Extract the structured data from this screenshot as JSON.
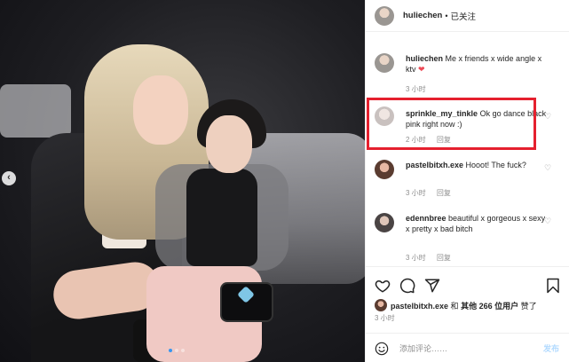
{
  "photo": {
    "nav_prev_icon": "chevron-left-icon",
    "dots_count": 3,
    "active_dot": 0
  },
  "header": {
    "username": "huliechen",
    "separator": "•",
    "follow_status": "已关注"
  },
  "comments": [
    {
      "username": "huliechen",
      "text": "Me x friends x wide angle x ktv",
      "emoji": "❤",
      "time": "3 小时",
      "reply": ""
    },
    {
      "username": "sprinkle_my_tinkle",
      "text": "Ok go dance black pink right now :)",
      "time": "2 小时",
      "reply": "回复"
    },
    {
      "username": "pastelbitxh.exe",
      "text": "Hooot! The fuck?",
      "time": "3 小时",
      "reply": "回复"
    },
    {
      "username": "edennbree",
      "text": "beautiful x gorgeous x sexy x pretty x bad bitch",
      "time": "3 小时",
      "reply": "回复"
    }
  ],
  "likes": {
    "user": "pastelbitxh.exe",
    "middle": "和",
    "others": "其他 266 位用户",
    "suffix": "赞了"
  },
  "post_time": "3 小时",
  "add_comment": {
    "placeholder": "添加评论……",
    "post_label": "发布"
  },
  "colors": {
    "highlight": "#e5202e",
    "like_heart": "#ed4956",
    "post_button": "#b3dbff"
  }
}
